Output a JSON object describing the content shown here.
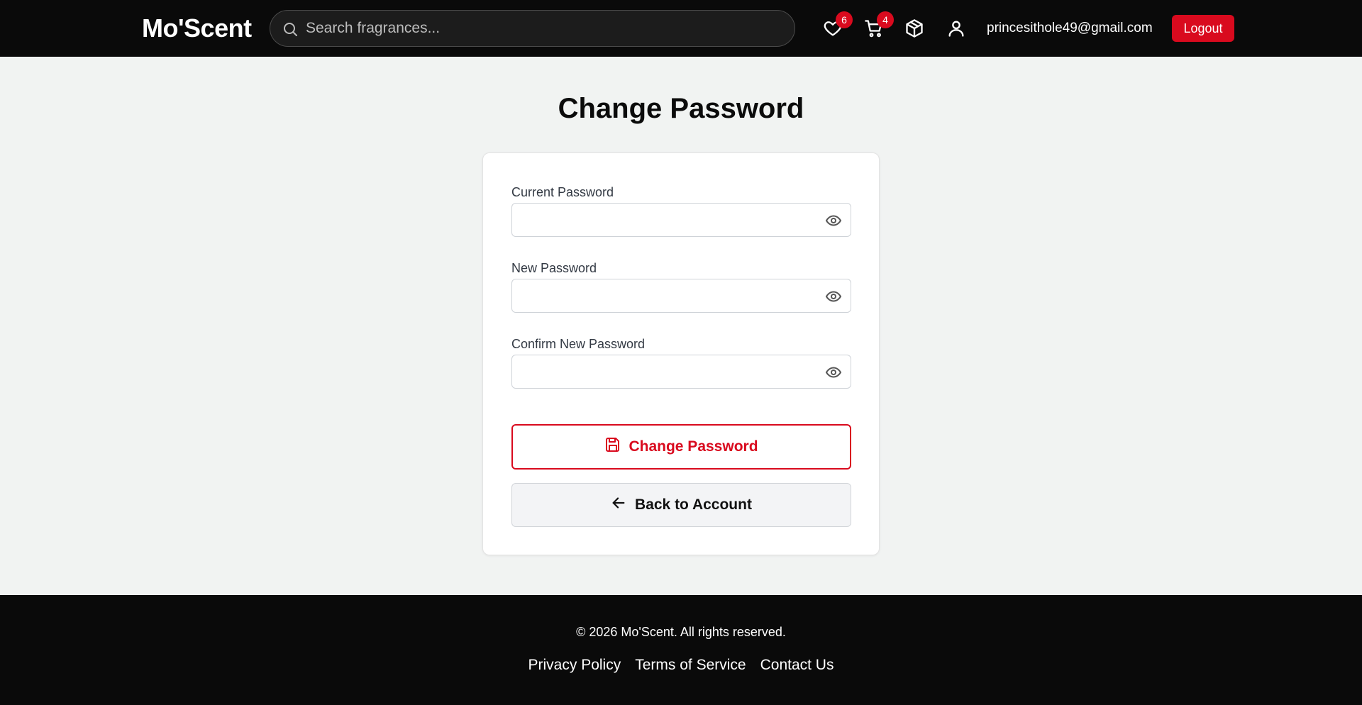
{
  "header": {
    "logo": "Mo'Scent",
    "search_placeholder": "Search fragrances...",
    "wishlist_count": "6",
    "cart_count": "4",
    "user_email": "princesithole49@gmail.com",
    "logout_label": "Logout"
  },
  "main": {
    "title": "Change Password",
    "fields": [
      {
        "label": "Current Password"
      },
      {
        "label": "New Password"
      },
      {
        "label": "Confirm New Password"
      }
    ],
    "submit_label": "Change Password",
    "back_label": "Back to Account"
  },
  "footer": {
    "copyright": "© 2026 Mo'Scent. All rights reserved.",
    "links": [
      "Privacy Policy",
      "Terms of Service",
      "Contact Us"
    ]
  },
  "colors": {
    "accent": "#d90a1e",
    "header_bg": "#0a0a0a",
    "page_bg": "#f1f3f2"
  }
}
